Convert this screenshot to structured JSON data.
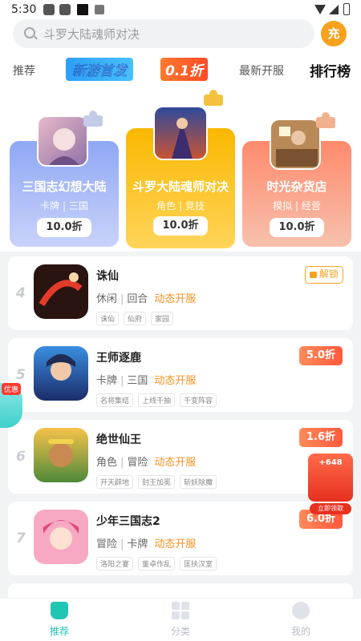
{
  "status_bar": {
    "time": "5:30"
  },
  "search": {
    "placeholder": "斗罗大陆魂师对决",
    "charge_label": "充"
  },
  "tabs": [
    {
      "label": "推荐"
    },
    {
      "label": "新游首发"
    },
    {
      "label": "0.1折"
    },
    {
      "label": "最新开服"
    },
    {
      "label": "排行榜"
    }
  ],
  "podium": [
    {
      "title": "三国志幻想大陆",
      "tags": "卡牌 | 三国",
      "discount": "10.0折"
    },
    {
      "title": "斗罗大陆魂师对决",
      "tags": "角色 | 竞技",
      "discount": "10.0折"
    },
    {
      "title": "时光杂货店",
      "tags": "模拟 | 经营",
      "discount": "10.0折"
    }
  ],
  "list": [
    {
      "rank": "4",
      "name": "诛仙",
      "genre1": "休闲",
      "genre2": "回合",
      "open": "动态开服",
      "chips": [
        "诛仙",
        "仙府",
        "家园"
      ],
      "action": "解锁"
    },
    {
      "rank": "5",
      "name": "王师逐鹿",
      "genre1": "卡牌",
      "genre2": "三国",
      "open": "动态开服",
      "chips": [
        "名将集结",
        "上线千抽",
        "千变阵容"
      ],
      "action": "5.0折"
    },
    {
      "rank": "6",
      "name": "绝世仙王",
      "genre1": "角色",
      "genre2": "冒险",
      "open": "动态开服",
      "chips": [
        "开天辟地",
        "封王加冕",
        "斩妖除魔"
      ],
      "action": "1.6折"
    },
    {
      "rank": "7",
      "name": "少年三国志2",
      "genre1": "冒险",
      "genre2": "卡牌",
      "open": "动态开服",
      "chips": [
        "洛阳之宴",
        "董卓作乱",
        "匡扶汉室"
      ],
      "action": "6.0折"
    }
  ],
  "floats": {
    "left_tag": "优惠",
    "redpack_amount": "+648",
    "redpack_cta": "立即领取"
  },
  "bottom_nav": [
    {
      "label": "推荐"
    },
    {
      "label": "分类"
    },
    {
      "label": "我的"
    }
  ],
  "colors": {
    "accent": "#1fc6b4",
    "orange": "#f7901e",
    "discount": "#ff5a3c"
  }
}
